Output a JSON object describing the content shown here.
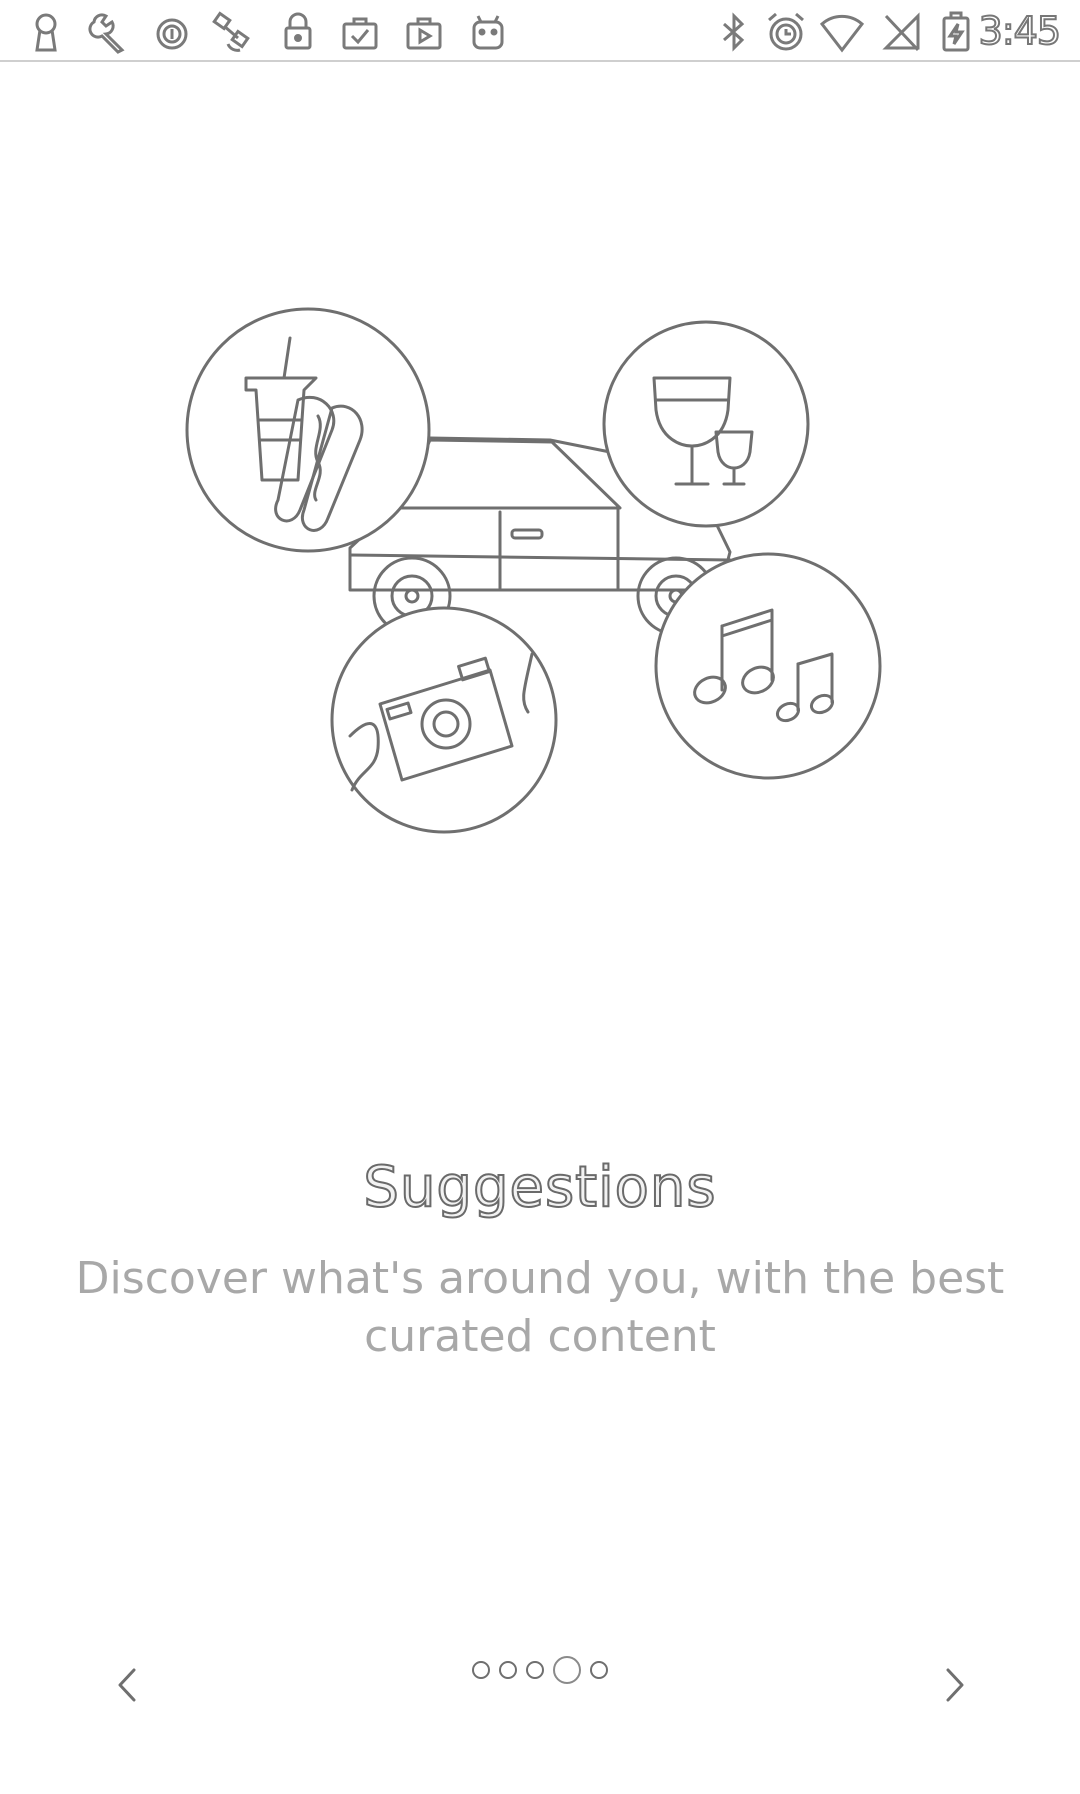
{
  "status_bar": {
    "left_icons": [
      "keyhole-icon",
      "wrench-icon",
      "circle-info-icon",
      "satellite-icon",
      "lock-icon",
      "briefcase-check-icon",
      "briefcase-play-icon",
      "android-icon"
    ],
    "right_icons": [
      "bluetooth-icon",
      "alarm-icon",
      "wifi-icon",
      "no-signal-icon",
      "battery-charging-icon"
    ],
    "time": "3:45"
  },
  "onboarding": {
    "illustration_icons": [
      "car-icon",
      "drink-hotdog-icon",
      "wine-glasses-icon",
      "camera-icon",
      "music-notes-icon"
    ],
    "title": "Suggestions",
    "description": "Discover what's around you, with the best curated content"
  },
  "pager": {
    "total_pages": 5,
    "current_page": 4,
    "prev_icon": "chevron-left-icon",
    "next_icon": "chevron-right-icon"
  },
  "colors": {
    "background": "#ffffff",
    "line_art": "#6f6f6f",
    "subtitle": "#a8a8a8"
  }
}
